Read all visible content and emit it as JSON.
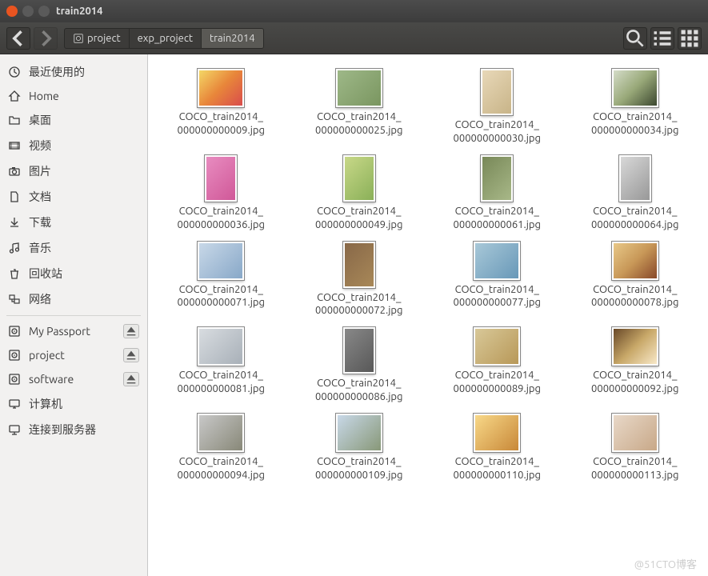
{
  "window": {
    "title": "train2014"
  },
  "breadcrumb": [
    {
      "label": "project",
      "has_icon": true
    },
    {
      "label": "exp_project"
    },
    {
      "label": "train2014",
      "active": true
    }
  ],
  "sidebar": {
    "places": [
      {
        "label": "最近使用的",
        "icon": "clock"
      },
      {
        "label": "Home",
        "icon": "home"
      },
      {
        "label": "桌面",
        "icon": "folder"
      },
      {
        "label": "视频",
        "icon": "video"
      },
      {
        "label": "图片",
        "icon": "camera"
      },
      {
        "label": "文档",
        "icon": "document"
      },
      {
        "label": "下载",
        "icon": "download"
      },
      {
        "label": "音乐",
        "icon": "music"
      },
      {
        "label": "回收站",
        "icon": "trash"
      },
      {
        "label": "网络",
        "icon": "network"
      }
    ],
    "devices": [
      {
        "label": "My Passport",
        "icon": "disk",
        "eject": true
      },
      {
        "label": "project",
        "icon": "disk",
        "eject": true
      },
      {
        "label": "software",
        "icon": "disk",
        "eject": true
      },
      {
        "label": "计算机",
        "icon": "computer"
      },
      {
        "label": "连接到服务器",
        "icon": "server"
      }
    ]
  },
  "files": [
    {
      "line1": "COCO_train2014_",
      "line2": "000000000009.jpg",
      "cls": "c1",
      "p": false
    },
    {
      "line1": "COCO_train2014_",
      "line2": "000000000025.jpg",
      "cls": "c2",
      "p": false
    },
    {
      "line1": "COCO_train2014_",
      "line2": "000000000030.jpg",
      "cls": "c3",
      "p": true
    },
    {
      "line1": "COCO_train2014_",
      "line2": "000000000034.jpg",
      "cls": "c4",
      "p": false
    },
    {
      "line1": "COCO_train2014_",
      "line2": "000000000036.jpg",
      "cls": "c5",
      "p": true
    },
    {
      "line1": "COCO_train2014_",
      "line2": "000000000049.jpg",
      "cls": "c6",
      "p": true
    },
    {
      "line1": "COCO_train2014_",
      "line2": "000000000061.jpg",
      "cls": "c7",
      "p": true
    },
    {
      "line1": "COCO_train2014_",
      "line2": "000000000064.jpg",
      "cls": "c8",
      "p": true
    },
    {
      "line1": "COCO_train2014_",
      "line2": "000000000071.jpg",
      "cls": "c9",
      "p": false
    },
    {
      "line1": "COCO_train2014_",
      "line2": "000000000072.jpg",
      "cls": "c10",
      "p": true
    },
    {
      "line1": "COCO_train2014_",
      "line2": "000000000077.jpg",
      "cls": "c11",
      "p": false
    },
    {
      "line1": "COCO_train2014_",
      "line2": "000000000078.jpg",
      "cls": "c12",
      "p": false
    },
    {
      "line1": "COCO_train2014_",
      "line2": "000000000081.jpg",
      "cls": "c13",
      "p": false
    },
    {
      "line1": "COCO_train2014_",
      "line2": "000000000086.jpg",
      "cls": "c14",
      "p": true
    },
    {
      "line1": "COCO_train2014_",
      "line2": "000000000089.jpg",
      "cls": "c15",
      "p": false
    },
    {
      "line1": "COCO_train2014_",
      "line2": "000000000092.jpg",
      "cls": "c16",
      "p": false
    },
    {
      "line1": "COCO_train2014_",
      "line2": "000000000094.jpg",
      "cls": "c17",
      "p": false
    },
    {
      "line1": "COCO_train2014_",
      "line2": "000000000109.jpg",
      "cls": "c18",
      "p": false
    },
    {
      "line1": "COCO_train2014_",
      "line2": "000000000110.jpg",
      "cls": "c19",
      "p": false
    },
    {
      "line1": "COCO_train2014_",
      "line2": "000000000113.jpg",
      "cls": "c20",
      "p": false
    }
  ],
  "watermark": "@51CTO博客"
}
